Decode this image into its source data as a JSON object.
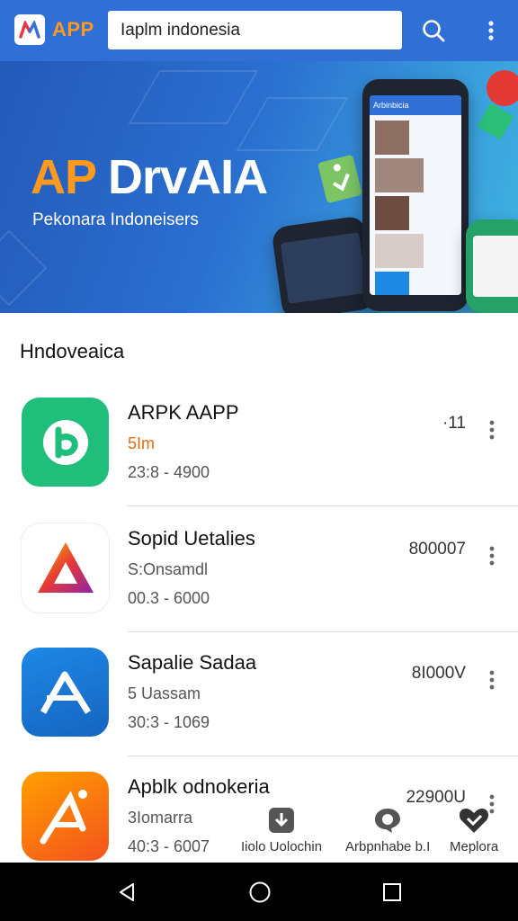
{
  "topbar": {
    "logo_text": "APP",
    "search_value": "Iaplm indonesia",
    "search_placeholder": "Iaplm indonesia",
    "colors": {
      "bar": "#2f6fd6",
      "logo": "#ff9a1f"
    }
  },
  "banner": {
    "title_accent": "AP",
    "title_rest": " DrvAIA",
    "subtitle": "Pekonara Indoneisers",
    "phone_header": "Arbinbicia"
  },
  "section": {
    "title": "Hndoveaica"
  },
  "apps": [
    {
      "name": "ARPK AAPP",
      "meta": "5Im",
      "stat": "23:8 - 4900",
      "count": "·11",
      "icon": "green-b-icon"
    },
    {
      "name": "Sopid Uetalies",
      "meta": "S:Onsamdl",
      "stat": "00.3 - 6000",
      "count": "800007",
      "icon": "gradient-a-icon"
    },
    {
      "name": "Sapalie Sadaa",
      "meta": "5 Uassam",
      "stat": "30:3 - 1069",
      "count": "8I000V",
      "icon": "blue-a-icon"
    },
    {
      "name": "Apblk odnokeria",
      "meta": "3Iomarra",
      "stat": "40:3 - 6007",
      "count": "22900U",
      "icon": "orange-a-icon"
    }
  ],
  "bottom_nav": [
    {
      "label": "Iiolo Uolochin",
      "icon": "download-icon"
    },
    {
      "label": "Arbpnhabe b.I",
      "icon": "chat-icon"
    },
    {
      "label": "Meplora",
      "icon": "heart-icon"
    }
  ]
}
